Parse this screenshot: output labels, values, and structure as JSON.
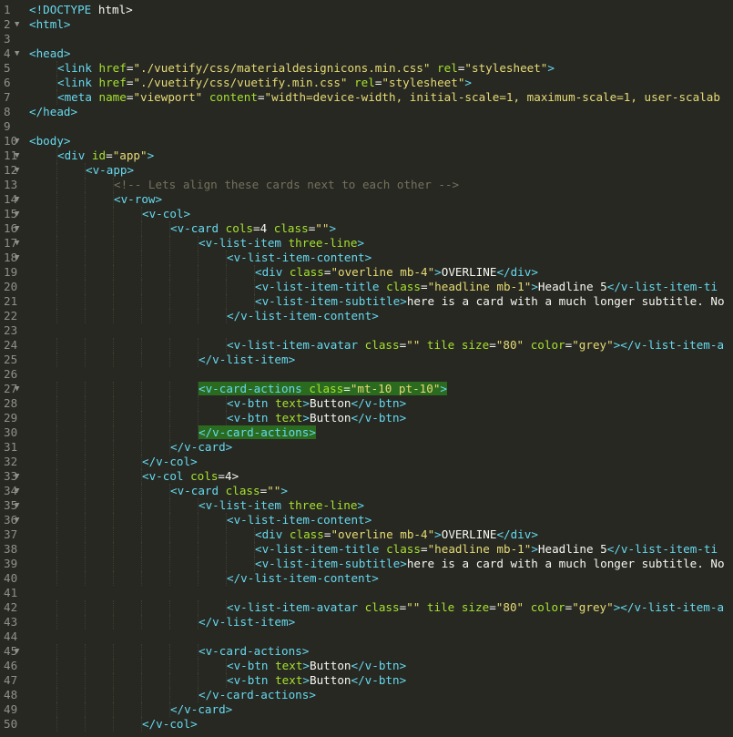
{
  "editor": {
    "language": "html",
    "colors": {
      "background": "#272822",
      "tag": "#66d9ef",
      "attribute": "#a6e22e",
      "string": "#e6db74",
      "text": "#f8f8f2",
      "comment": "#75715e",
      "line_number": "#8f908a",
      "highlight": "#2b6b1f"
    },
    "lines": [
      {
        "n": "1",
        "fold": "",
        "indent": 0,
        "tokens": [
          {
            "t": "<!DOCTYPE",
            "c": "tag"
          },
          {
            "t": " html>",
            "c": "txt"
          }
        ]
      },
      {
        "n": "2",
        "fold": "▼",
        "indent": 0,
        "tokens": [
          {
            "t": "<html>",
            "c": "tag"
          }
        ]
      },
      {
        "n": "3",
        "fold": "",
        "indent": 0,
        "tokens": []
      },
      {
        "n": "4",
        "fold": "▼",
        "indent": 0,
        "tokens": [
          {
            "t": "<head>",
            "c": "tag"
          }
        ]
      },
      {
        "n": "5",
        "fold": "",
        "indent": 1,
        "tokens": [
          {
            "t": "<link ",
            "c": "tag"
          },
          {
            "t": "href",
            "c": "attr"
          },
          {
            "t": "=",
            "c": "txt"
          },
          {
            "t": "\"./vuetify/css/materialdesignicons.min.css\"",
            "c": "str"
          },
          {
            "t": " rel",
            "c": "attr"
          },
          {
            "t": "=",
            "c": "txt"
          },
          {
            "t": "\"stylesheet\"",
            "c": "str"
          },
          {
            "t": ">",
            "c": "tag"
          }
        ]
      },
      {
        "n": "6",
        "fold": "",
        "indent": 1,
        "tokens": [
          {
            "t": "<link ",
            "c": "tag"
          },
          {
            "t": "href",
            "c": "attr"
          },
          {
            "t": "=",
            "c": "txt"
          },
          {
            "t": "\"./vuetify/css/vuetify.min.css\"",
            "c": "str"
          },
          {
            "t": " rel",
            "c": "attr"
          },
          {
            "t": "=",
            "c": "txt"
          },
          {
            "t": "\"stylesheet\"",
            "c": "str"
          },
          {
            "t": ">",
            "c": "tag"
          }
        ]
      },
      {
        "n": "7",
        "fold": "",
        "indent": 1,
        "tokens": [
          {
            "t": "<meta ",
            "c": "tag"
          },
          {
            "t": "name",
            "c": "attr"
          },
          {
            "t": "=",
            "c": "txt"
          },
          {
            "t": "\"viewport\"",
            "c": "str"
          },
          {
            "t": " content",
            "c": "attr"
          },
          {
            "t": "=",
            "c": "txt"
          },
          {
            "t": "\"width=device-width, initial-scale=1, maximum-scale=1, user-scalab",
            "c": "str"
          }
        ]
      },
      {
        "n": "8",
        "fold": "",
        "indent": 0,
        "tokens": [
          {
            "t": "</head>",
            "c": "tag"
          }
        ]
      },
      {
        "n": "9",
        "fold": "",
        "indent": 0,
        "tokens": []
      },
      {
        "n": "10",
        "fold": "▼",
        "indent": 0,
        "tokens": [
          {
            "t": "<body>",
            "c": "tag"
          }
        ]
      },
      {
        "n": "11",
        "fold": "▼",
        "indent": 1,
        "tokens": [
          {
            "t": "<div ",
            "c": "tag"
          },
          {
            "t": "id",
            "c": "attr"
          },
          {
            "t": "=",
            "c": "txt"
          },
          {
            "t": "\"app\"",
            "c": "str"
          },
          {
            "t": ">",
            "c": "tag"
          }
        ]
      },
      {
        "n": "12",
        "fold": "▼",
        "indent": 2,
        "tokens": [
          {
            "t": "<v-app>",
            "c": "tag"
          }
        ]
      },
      {
        "n": "13",
        "fold": "",
        "indent": 3,
        "tokens": [
          {
            "t": "<!-- Lets align these cards next to each other -->",
            "c": "cmt"
          }
        ]
      },
      {
        "n": "14",
        "fold": "▼",
        "indent": 3,
        "tokens": [
          {
            "t": "<v-row>",
            "c": "tag"
          }
        ]
      },
      {
        "n": "15",
        "fold": "▼",
        "indent": 4,
        "tokens": [
          {
            "t": "<v-col>",
            "c": "tag"
          }
        ]
      },
      {
        "n": "16",
        "fold": "▼",
        "indent": 5,
        "tokens": [
          {
            "t": "<v-card ",
            "c": "tag"
          },
          {
            "t": "cols",
            "c": "attr"
          },
          {
            "t": "=4 ",
            "c": "txt"
          },
          {
            "t": "class",
            "c": "attr"
          },
          {
            "t": "=",
            "c": "txt"
          },
          {
            "t": "\"\"",
            "c": "str"
          },
          {
            "t": ">",
            "c": "tag"
          }
        ]
      },
      {
        "n": "17",
        "fold": "▼",
        "indent": 6,
        "tokens": [
          {
            "t": "<v-list-item ",
            "c": "tag"
          },
          {
            "t": "three-line",
            "c": "attr"
          },
          {
            "t": ">",
            "c": "tag"
          }
        ]
      },
      {
        "n": "18",
        "fold": "▼",
        "indent": 7,
        "tokens": [
          {
            "t": "<v-list-item-content>",
            "c": "tag"
          }
        ]
      },
      {
        "n": "19",
        "fold": "",
        "indent": 8,
        "tokens": [
          {
            "t": "<div ",
            "c": "tag"
          },
          {
            "t": "class",
            "c": "attr"
          },
          {
            "t": "=",
            "c": "txt"
          },
          {
            "t": "\"overline mb-4\"",
            "c": "str"
          },
          {
            "t": ">",
            "c": "tag"
          },
          {
            "t": "OVERLINE",
            "c": "txt"
          },
          {
            "t": "</div>",
            "c": "tag"
          }
        ]
      },
      {
        "n": "20",
        "fold": "",
        "indent": 8,
        "tokens": [
          {
            "t": "<v-list-item-title ",
            "c": "tag"
          },
          {
            "t": "class",
            "c": "attr"
          },
          {
            "t": "=",
            "c": "txt"
          },
          {
            "t": "\"headline mb-1\"",
            "c": "str"
          },
          {
            "t": ">",
            "c": "tag"
          },
          {
            "t": "Headline 5",
            "c": "txt"
          },
          {
            "t": "</v-list-item-ti",
            "c": "tag"
          }
        ]
      },
      {
        "n": "21",
        "fold": "",
        "indent": 8,
        "tokens": [
          {
            "t": "<v-list-item-subtitle>",
            "c": "tag"
          },
          {
            "t": "here is a card with a much longer subtitle. No",
            "c": "txt"
          }
        ]
      },
      {
        "n": "22",
        "fold": "",
        "indent": 7,
        "tokens": [
          {
            "t": "</v-list-item-content>",
            "c": "tag"
          }
        ]
      },
      {
        "n": "23",
        "fold": "",
        "indent": 0,
        "tokens": []
      },
      {
        "n": "24",
        "fold": "",
        "indent": 7,
        "tokens": [
          {
            "t": "<v-list-item-avatar ",
            "c": "tag"
          },
          {
            "t": "class",
            "c": "attr"
          },
          {
            "t": "=",
            "c": "txt"
          },
          {
            "t": "\"\"",
            "c": "str"
          },
          {
            "t": " tile ",
            "c": "attr"
          },
          {
            "t": "size",
            "c": "attr"
          },
          {
            "t": "=",
            "c": "txt"
          },
          {
            "t": "\"80\"",
            "c": "str"
          },
          {
            "t": " color",
            "c": "attr"
          },
          {
            "t": "=",
            "c": "txt"
          },
          {
            "t": "\"grey\"",
            "c": "str"
          },
          {
            "t": "></v-list-item-a",
            "c": "tag"
          }
        ]
      },
      {
        "n": "25",
        "fold": "",
        "indent": 6,
        "tokens": [
          {
            "t": "</v-list-item>",
            "c": "tag"
          }
        ]
      },
      {
        "n": "26",
        "fold": "",
        "indent": 0,
        "tokens": []
      },
      {
        "n": "27",
        "fold": "▼",
        "indent": 6,
        "tokens": [
          {
            "t": "<v-card-actions ",
            "c": "tag",
            "h": true
          },
          {
            "t": "class",
            "c": "attr",
            "h": true
          },
          {
            "t": "=",
            "c": "txt",
            "h": true
          },
          {
            "t": "\"mt-10 pt-10\"",
            "c": "str",
            "h": true
          },
          {
            "t": ">",
            "c": "tag",
            "h": true
          }
        ]
      },
      {
        "n": "28",
        "fold": "",
        "indent": 7,
        "tokens": [
          {
            "t": "<v-btn ",
            "c": "tag"
          },
          {
            "t": "text",
            "c": "attr"
          },
          {
            "t": ">",
            "c": "tag"
          },
          {
            "t": "Button",
            "c": "txt"
          },
          {
            "t": "</v-btn>",
            "c": "tag"
          }
        ]
      },
      {
        "n": "29",
        "fold": "",
        "indent": 7,
        "tokens": [
          {
            "t": "<v-btn ",
            "c": "tag"
          },
          {
            "t": "text",
            "c": "attr"
          },
          {
            "t": ">",
            "c": "tag"
          },
          {
            "t": "Button",
            "c": "txt"
          },
          {
            "t": "</v-btn>",
            "c": "tag"
          }
        ]
      },
      {
        "n": "30",
        "fold": "",
        "indent": 6,
        "tokens": [
          {
            "t": "</v-card-actions>",
            "c": "tag",
            "h": true
          }
        ]
      },
      {
        "n": "31",
        "fold": "",
        "indent": 5,
        "tokens": [
          {
            "t": "</v-card>",
            "c": "tag"
          }
        ]
      },
      {
        "n": "32",
        "fold": "",
        "indent": 4,
        "tokens": [
          {
            "t": "</v-col>",
            "c": "tag"
          }
        ]
      },
      {
        "n": "33",
        "fold": "▼",
        "indent": 4,
        "tokens": [
          {
            "t": "<v-col ",
            "c": "tag"
          },
          {
            "t": "cols",
            "c": "attr"
          },
          {
            "t": "=4>",
            "c": "txt"
          }
        ]
      },
      {
        "n": "34",
        "fold": "▼",
        "indent": 5,
        "tokens": [
          {
            "t": "<v-card ",
            "c": "tag"
          },
          {
            "t": "class",
            "c": "attr"
          },
          {
            "t": "=",
            "c": "txt"
          },
          {
            "t": "\"\"",
            "c": "str"
          },
          {
            "t": ">",
            "c": "tag"
          }
        ]
      },
      {
        "n": "35",
        "fold": "▼",
        "indent": 6,
        "tokens": [
          {
            "t": "<v-list-item ",
            "c": "tag"
          },
          {
            "t": "three-line",
            "c": "attr"
          },
          {
            "t": ">",
            "c": "tag"
          }
        ]
      },
      {
        "n": "36",
        "fold": "▼",
        "indent": 7,
        "tokens": [
          {
            "t": "<v-list-item-content>",
            "c": "tag"
          }
        ]
      },
      {
        "n": "37",
        "fold": "",
        "indent": 8,
        "tokens": [
          {
            "t": "<div ",
            "c": "tag"
          },
          {
            "t": "class",
            "c": "attr"
          },
          {
            "t": "=",
            "c": "txt"
          },
          {
            "t": "\"overline mb-4\"",
            "c": "str"
          },
          {
            "t": ">",
            "c": "tag"
          },
          {
            "t": "OVERLINE",
            "c": "txt"
          },
          {
            "t": "</div>",
            "c": "tag"
          }
        ]
      },
      {
        "n": "38",
        "fold": "",
        "indent": 8,
        "tokens": [
          {
            "t": "<v-list-item-title ",
            "c": "tag"
          },
          {
            "t": "class",
            "c": "attr"
          },
          {
            "t": "=",
            "c": "txt"
          },
          {
            "t": "\"headline mb-1\"",
            "c": "str"
          },
          {
            "t": ">",
            "c": "tag"
          },
          {
            "t": "Headline 5",
            "c": "txt"
          },
          {
            "t": "</v-list-item-ti",
            "c": "tag"
          }
        ]
      },
      {
        "n": "39",
        "fold": "",
        "indent": 8,
        "tokens": [
          {
            "t": "<v-list-item-subtitle>",
            "c": "tag"
          },
          {
            "t": "here is a card with a much longer subtitle. No",
            "c": "txt"
          }
        ]
      },
      {
        "n": "40",
        "fold": "",
        "indent": 7,
        "tokens": [
          {
            "t": "</v-list-item-content>",
            "c": "tag"
          }
        ]
      },
      {
        "n": "41",
        "fold": "",
        "indent": 0,
        "tokens": []
      },
      {
        "n": "42",
        "fold": "",
        "indent": 7,
        "tokens": [
          {
            "t": "<v-list-item-avatar ",
            "c": "tag"
          },
          {
            "t": "class",
            "c": "attr"
          },
          {
            "t": "=",
            "c": "txt"
          },
          {
            "t": "\"\"",
            "c": "str"
          },
          {
            "t": " tile ",
            "c": "attr"
          },
          {
            "t": "size",
            "c": "attr"
          },
          {
            "t": "=",
            "c": "txt"
          },
          {
            "t": "\"80\"",
            "c": "str"
          },
          {
            "t": " color",
            "c": "attr"
          },
          {
            "t": "=",
            "c": "txt"
          },
          {
            "t": "\"grey\"",
            "c": "str"
          },
          {
            "t": "></v-list-item-a",
            "c": "tag"
          }
        ]
      },
      {
        "n": "43",
        "fold": "",
        "indent": 6,
        "tokens": [
          {
            "t": "</v-list-item>",
            "c": "tag"
          }
        ]
      },
      {
        "n": "44",
        "fold": "",
        "indent": 0,
        "tokens": []
      },
      {
        "n": "45",
        "fold": "▼",
        "indent": 6,
        "tokens": [
          {
            "t": "<v-card-actions>",
            "c": "tag"
          }
        ]
      },
      {
        "n": "46",
        "fold": "",
        "indent": 7,
        "tokens": [
          {
            "t": "<v-btn ",
            "c": "tag"
          },
          {
            "t": "text",
            "c": "attr"
          },
          {
            "t": ">",
            "c": "tag"
          },
          {
            "t": "Button",
            "c": "txt"
          },
          {
            "t": "</v-btn>",
            "c": "tag"
          }
        ]
      },
      {
        "n": "47",
        "fold": "",
        "indent": 7,
        "tokens": [
          {
            "t": "<v-btn ",
            "c": "tag"
          },
          {
            "t": "text",
            "c": "attr"
          },
          {
            "t": ">",
            "c": "tag"
          },
          {
            "t": "Button",
            "c": "txt"
          },
          {
            "t": "</v-btn>",
            "c": "tag"
          }
        ]
      },
      {
        "n": "48",
        "fold": "",
        "indent": 6,
        "tokens": [
          {
            "t": "</v-card-actions>",
            "c": "tag"
          }
        ]
      },
      {
        "n": "49",
        "fold": "",
        "indent": 5,
        "tokens": [
          {
            "t": "</v-card>",
            "c": "tag"
          }
        ]
      },
      {
        "n": "50",
        "fold": "",
        "indent": 4,
        "tokens": [
          {
            "t": "</v-col>",
            "c": "tag"
          }
        ]
      }
    ]
  }
}
